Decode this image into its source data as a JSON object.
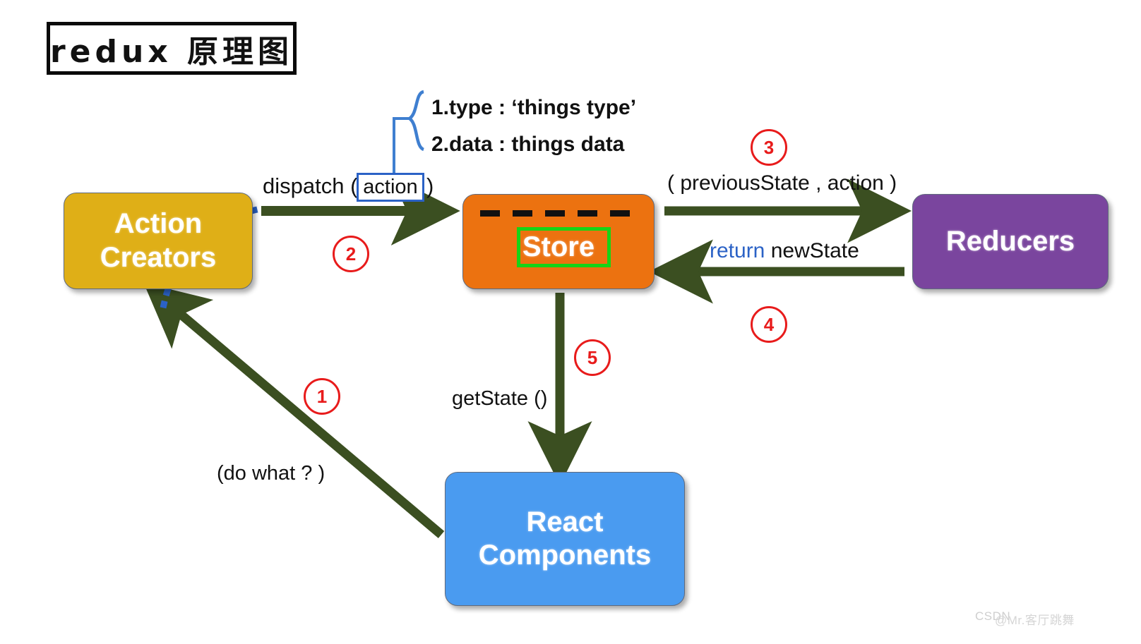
{
  "title": {
    "text": "redux 原理图"
  },
  "nodes": {
    "action_creators": {
      "label_line1": "Action",
      "label_line2": "Creators",
      "color": "#dfaf17"
    },
    "store": {
      "label": "Store",
      "color": "#ec7210",
      "highlight_color": "#16d416"
    },
    "reducers": {
      "label": "Reducers",
      "color": "#7a459e"
    },
    "react_components": {
      "label_line1": "React",
      "label_line2": "Components",
      "color": "#4a9bf0"
    }
  },
  "labels": {
    "brace_line_1": "1.type :  ‘things type’",
    "brace_line_2": "2.data :   things data",
    "dispatch_prefix": "dispatch (",
    "dispatch_action": "action",
    "dispatch_suffix": ")",
    "previous_state": "( previousState , action )",
    "return_keyword": "return",
    "return_value": " newState",
    "get_state": "getState ()",
    "do_what": "(do what ? )"
  },
  "steps": {
    "one": "1",
    "two": "2",
    "three": "3",
    "four": "4",
    "five": "5"
  },
  "colors": {
    "arrow_green": "#3b4f21",
    "dotted_blue": "#2b62c6",
    "step_red": "#e81b1b",
    "brace_blue": "#3f7fd0"
  },
  "watermark": {
    "text_a": "CSDN",
    "text_b": "@Mr.客厅跳舞"
  }
}
